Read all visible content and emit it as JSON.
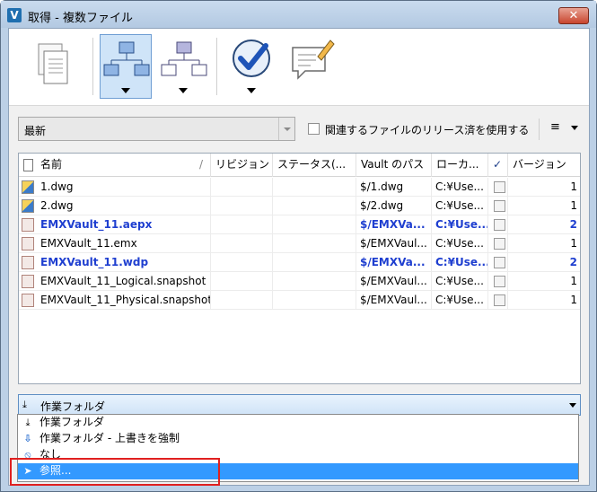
{
  "window": {
    "title": "取得 - 複数ファイル",
    "app_icon_letter": "V",
    "close_glyph": "✕"
  },
  "toolbar": {
    "buttons": [
      {
        "name": "copy-design-icon"
      },
      {
        "name": "structure-icon"
      },
      {
        "name": "structure-alt-icon"
      },
      {
        "name": "checkmark-icon"
      },
      {
        "name": "comment-icon"
      }
    ]
  },
  "filter": {
    "revision_value": "最新",
    "use_released_label": "関連するファイルのリリース済を使用する",
    "list_icon_glyph": "≡"
  },
  "grid": {
    "columns": [
      "名前",
      "リビジョン",
      "ステータス(...",
      "Vault のパス",
      "ローカ...",
      "✓",
      "バージョン"
    ],
    "rows": [
      {
        "name": "1.dwg",
        "rev": "",
        "status": "",
        "vault_path": "$/1.dwg",
        "local": "C:¥Use...",
        "version": "1",
        "bold": false,
        "icon": "dwg"
      },
      {
        "name": "2.dwg",
        "rev": "",
        "status": "",
        "vault_path": "$/2.dwg",
        "local": "C:¥Use...",
        "version": "1",
        "bold": false,
        "icon": "dwg"
      },
      {
        "name": "EMXVault_11.aepx",
        "rev": "",
        "status": "",
        "vault_path": "$/EMXVa...",
        "local": "C:¥Use...",
        "version": "2",
        "bold": true,
        "icon": "mod"
      },
      {
        "name": "EMXVault_11.emx",
        "rev": "",
        "status": "",
        "vault_path": "$/EMXVaul...",
        "local": "C:¥Use...",
        "version": "1",
        "bold": false,
        "icon": "mod"
      },
      {
        "name": "EMXVault_11.wdp",
        "rev": "",
        "status": "",
        "vault_path": "$/EMXVa...",
        "local": "C:¥Use...",
        "version": "2",
        "bold": true,
        "icon": "mod"
      },
      {
        "name": "EMXVault_11_Logical.snapshot",
        "rev": "",
        "status": "",
        "vault_path": "$/EMXVaul...",
        "local": "C:¥Use...",
        "version": "1",
        "bold": false,
        "icon": "mod"
      },
      {
        "name": "EMXVault_11_Physical.snapshot",
        "rev": "",
        "status": "",
        "vault_path": "$/EMXVaul...",
        "local": "C:¥Use...",
        "version": "1",
        "bold": false,
        "icon": "mod"
      }
    ]
  },
  "target": {
    "selected_value": "作業フォルダ",
    "options": [
      {
        "label": "作業フォルダ",
        "icon": "download-icon",
        "glyph": "⤓"
      },
      {
        "label": "作業フォルダ - 上書きを強制",
        "icon": "arrow-down-icon",
        "glyph": "⇩"
      },
      {
        "label": "なし",
        "icon": "none-icon",
        "glyph": "⦸"
      },
      {
        "label": "参照...",
        "icon": "cursor-icon",
        "glyph": "➤"
      }
    ]
  },
  "colors": {
    "highlight": "#3399ff",
    "bold_text": "#1f3fd0",
    "annotation_box": "#e02020"
  }
}
